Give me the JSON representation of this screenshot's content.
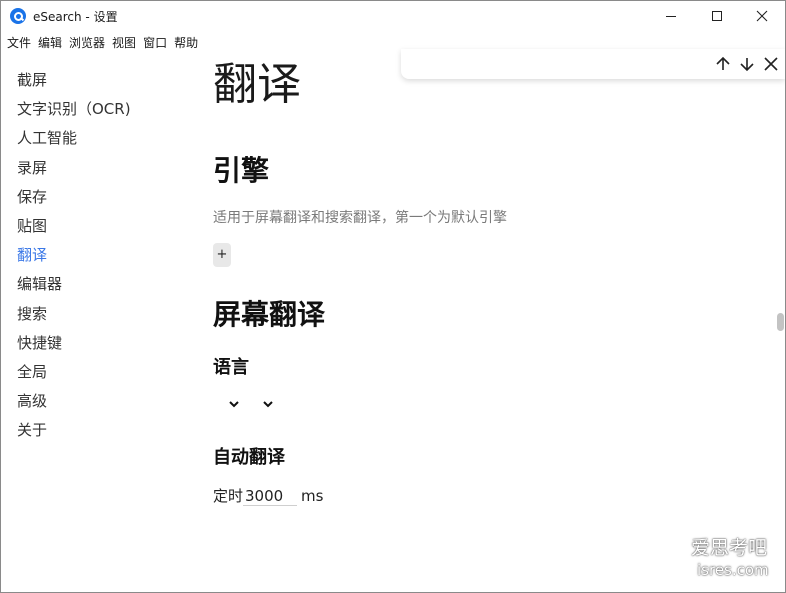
{
  "window": {
    "title": "eSearch - 设置",
    "icon": "esearch-app-icon"
  },
  "menu": [
    "文件",
    "编辑",
    "浏览器",
    "视图",
    "窗口",
    "帮助"
  ],
  "sidebar": {
    "items": [
      {
        "label": "截屏"
      },
      {
        "label": "文字识别（OCR)"
      },
      {
        "label": "人工智能"
      },
      {
        "label": "录屏"
      },
      {
        "label": "保存"
      },
      {
        "label": "贴图"
      },
      {
        "label": "翻译"
      },
      {
        "label": "编辑器"
      },
      {
        "label": "搜索"
      },
      {
        "label": "快捷键"
      },
      {
        "label": "全局"
      },
      {
        "label": "高级"
      },
      {
        "label": "关于"
      }
    ],
    "active_index": 6,
    "active_color": "#3b78e7"
  },
  "main": {
    "title": "翻译",
    "engine_section": {
      "title": "引擎",
      "description": "适用于屏幕翻译和搜索翻译，第一个为默认引擎",
      "add_label": "+"
    },
    "screen_translate": {
      "title": "屏幕翻译",
      "language_label": "语言",
      "auto_title": "自动翻译",
      "timer_label": "定时",
      "timer_value": "3000",
      "timer_unit": "ms"
    }
  },
  "findbar": {
    "icons": [
      "arrow-up-icon",
      "arrow-down-icon",
      "close-icon"
    ]
  },
  "watermark": {
    "line1": "爱思考吧",
    "line2": "isres.com"
  }
}
